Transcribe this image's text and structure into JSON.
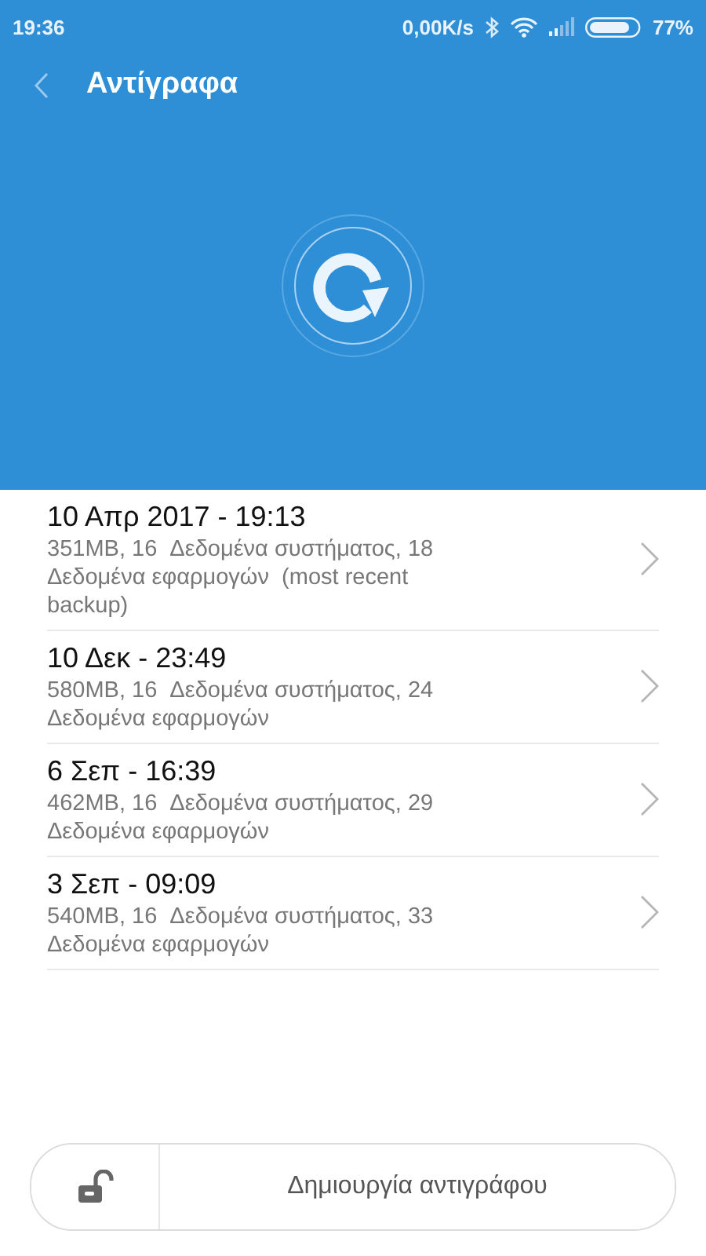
{
  "status_bar": {
    "time": "19:36",
    "speed": "0,00K/s",
    "battery": "77%"
  },
  "title": "Αντίγραφα",
  "backups": [
    {
      "date": "10 Απρ 2017 - 19:13",
      "details": "351MB, 16  Δεδομένα συστήματος, 18 Δεδομένα εφαρμογών  (most recent backup)"
    },
    {
      "date": "10 Δεκ - 23:49",
      "details": "580MB, 16  Δεδομένα συστήματος, 24 Δεδομένα εφαρμογών"
    },
    {
      "date": "6 Σεπ - 16:39",
      "details": "462MB, 16  Δεδομένα συστήματος, 29 Δεδομένα εφαρμογών"
    },
    {
      "date": "3 Σεπ - 09:09",
      "details": "540MB, 16  Δεδομένα συστήματος, 33 Δεδομένα εφαρμογών"
    }
  ],
  "create_button": "Δημιουργία αντιγράφου"
}
